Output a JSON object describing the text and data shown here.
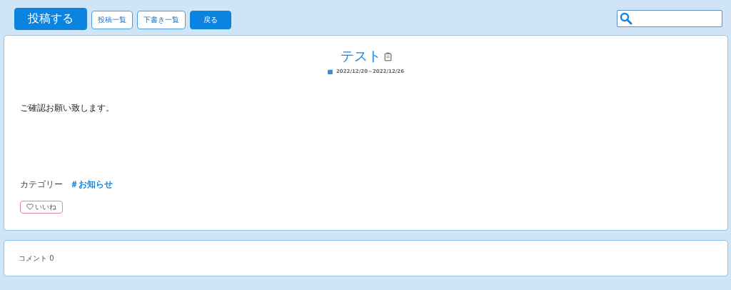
{
  "toolbar": {
    "buttons": [
      {
        "label": "投稿する",
        "kind": "large"
      },
      {
        "label": "投稿一覧",
        "kind": "outline"
      },
      {
        "label": "下書き一覧",
        "kind": "outline"
      },
      {
        "label": "戻る",
        "kind": "primary"
      }
    ]
  },
  "post": {
    "title": "テスト",
    "date_range": "2022/12/20～2022/12/26",
    "body": "ご確認お願い致します。",
    "category_label": "カテゴリー",
    "category": "＃お知らせ",
    "like": {
      "label": "いいね",
      "liked": false
    }
  },
  "comments": {
    "label": "コメント 0"
  }
}
